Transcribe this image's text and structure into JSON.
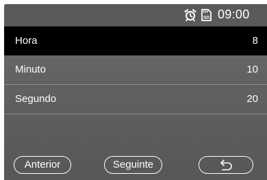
{
  "status_bar": {
    "time": "09:00",
    "icons": [
      "alarm-clock-icon",
      "sd-card-icon"
    ]
  },
  "settings": {
    "rows": [
      {
        "label": "Hora",
        "value": "8",
        "selected": true
      },
      {
        "label": "Minuto",
        "value": "10",
        "selected": false
      },
      {
        "label": "Segundo",
        "value": "20",
        "selected": false
      }
    ]
  },
  "buttons": {
    "previous_label": "Anterior",
    "next_label": "Seguinte",
    "back_icon": "return-arrow-icon"
  },
  "colors": {
    "background": "#606060",
    "selected_row": "#000000",
    "text": "#ffffff"
  }
}
